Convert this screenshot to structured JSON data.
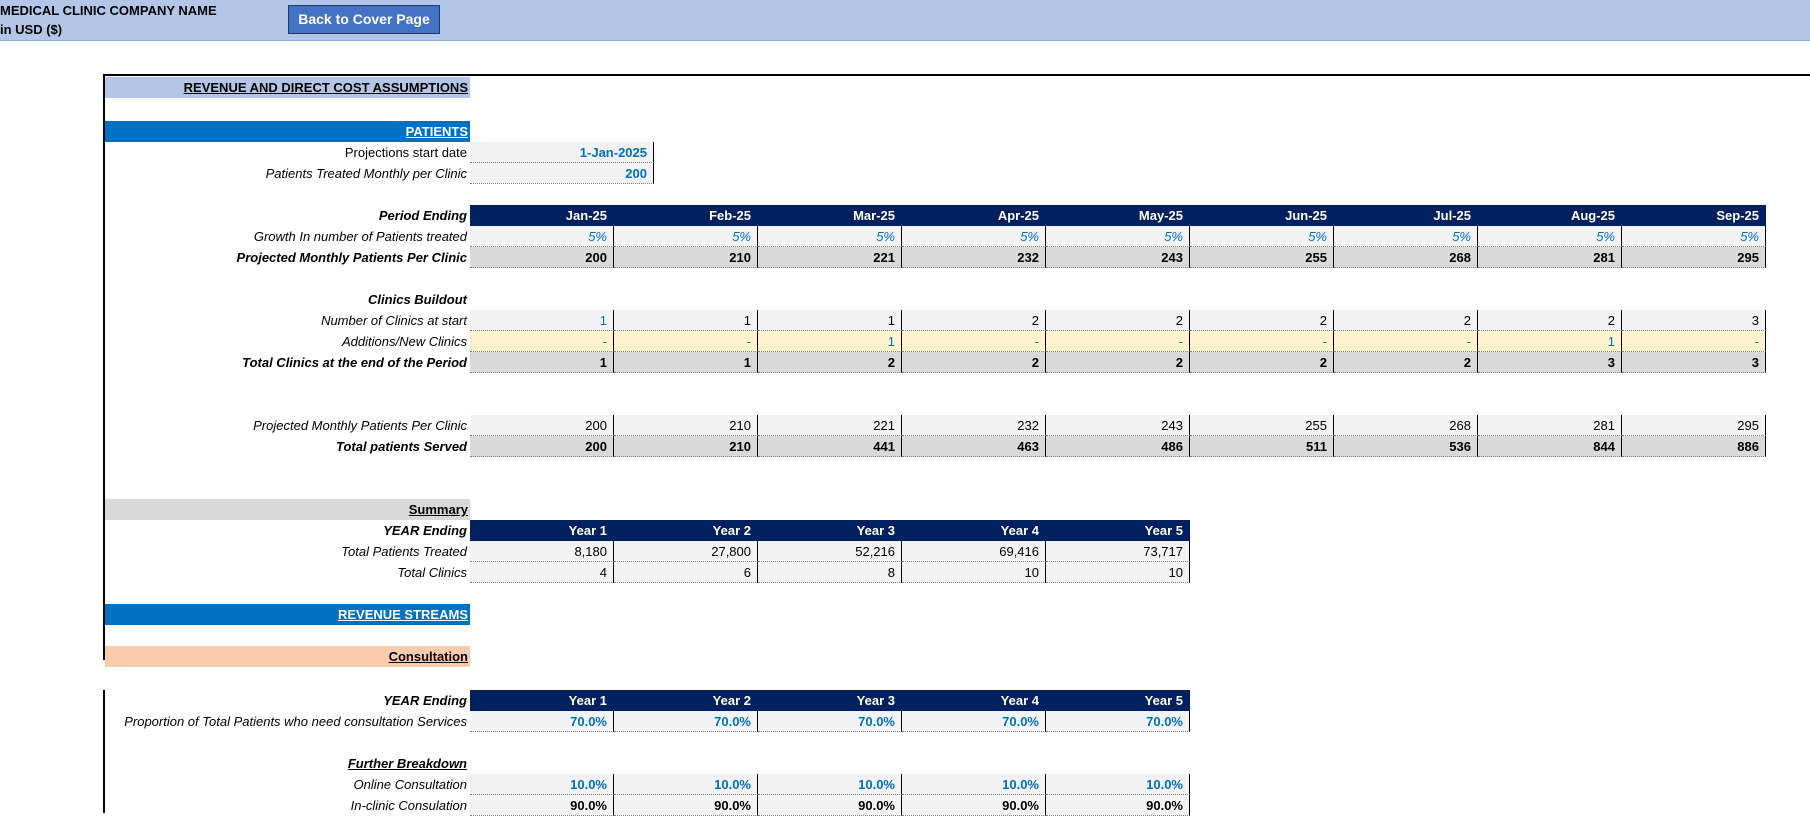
{
  "header": {
    "company": "MEDICAL CLINIC COMPANY NAME",
    "currency": "in USD ($)",
    "back_button": "Back to Cover Page"
  },
  "sections": {
    "main_title": "REVENUE AND DIRECT COST ASSUMPTIONS",
    "patients": "PATIENTS",
    "summary": "Summary",
    "revenue_streams": "REVENUE STREAMS",
    "consultation": "Consultation"
  },
  "colors": {
    "topbar": "#b4c6e7",
    "button": "#4472c4",
    "table_header": "#002060",
    "section_blue": "#0070c0",
    "section_light": "#b4c6e7",
    "section_gray": "#d9d9d9",
    "section_orange": "#f8cbad",
    "input_text": "#0070c0"
  },
  "inputs": {
    "start_date_label": "Projections  start date",
    "start_date": "1-Jan-2025",
    "patients_label": "Patients Treated  Monthly per Clinic",
    "patients_value": "200"
  },
  "monthly": {
    "period_label": "Period Ending",
    "months": [
      "Jan-25",
      "Feb-25",
      "Mar-25",
      "Apr-25",
      "May-25",
      "Jun-25",
      "Jul-25",
      "Aug-25",
      "Sep-25"
    ],
    "growth_label": "Growth In number of Patients treated",
    "growth": [
      "5%",
      "5%",
      "5%",
      "5%",
      "5%",
      "5%",
      "5%",
      "5%",
      "5%"
    ],
    "projected_label": "Projected  Monthly Patients Per Clinic",
    "projected": [
      "200",
      "210",
      "221",
      "232",
      "243",
      "255",
      "268",
      "281",
      "295"
    ],
    "buildout_label": "Clinics Buildout",
    "clinics_start_label": "Number of Clinics at start",
    "clinics_start": [
      "1",
      "1",
      "1",
      "2",
      "2",
      "2",
      "2",
      "2",
      "3"
    ],
    "additions_label": "Additions/New Clinics",
    "additions": [
      "-",
      "-",
      "1",
      "-",
      "-",
      "-",
      "-",
      "1",
      "-"
    ],
    "total_clinics_label": "Total Clinics at the end of the  Period",
    "total_clinics": [
      "1",
      "1",
      "2",
      "2",
      "2",
      "2",
      "2",
      "3",
      "3"
    ],
    "projected2_label": "Projected  Monthly Patients Per Clinic",
    "projected2": [
      "200",
      "210",
      "221",
      "232",
      "243",
      "255",
      "268",
      "281",
      "295"
    ],
    "served_label": "Total patients Served",
    "served": [
      "200",
      "210",
      "441",
      "463",
      "486",
      "511",
      "536",
      "844",
      "886"
    ]
  },
  "summary": {
    "year_label": "YEAR Ending",
    "years": [
      "Year 1",
      "Year 2",
      "Year 3",
      "Year 4",
      "Year 5"
    ],
    "patients_label": "Total Patients Treated",
    "patients": [
      "8,180",
      "27,800",
      "52,216",
      "69,416",
      "73,717"
    ],
    "clinics_label": "Total Clinics",
    "clinics": [
      "4",
      "6",
      "8",
      "10",
      "10"
    ]
  },
  "consultation": {
    "year_label": "YEAR Ending",
    "years": [
      "Year 1",
      "Year 2",
      "Year 3",
      "Year 4",
      "Year 5"
    ],
    "proportion_label": "Proportion of Total Patients who need consultation Services",
    "proportion": [
      "70.0%",
      "70.0%",
      "70.0%",
      "70.0%",
      "70.0%"
    ],
    "breakdown_label": "Further Breakdown",
    "online_label": "Online Consultation",
    "online": [
      "10.0%",
      "10.0%",
      "10.0%",
      "10.0%",
      "10.0%"
    ],
    "inclinic_label": "In-clinic Consulation",
    "inclinic": [
      "90.0%",
      "90.0%",
      "90.0%",
      "90.0%",
      "90.0%"
    ]
  }
}
